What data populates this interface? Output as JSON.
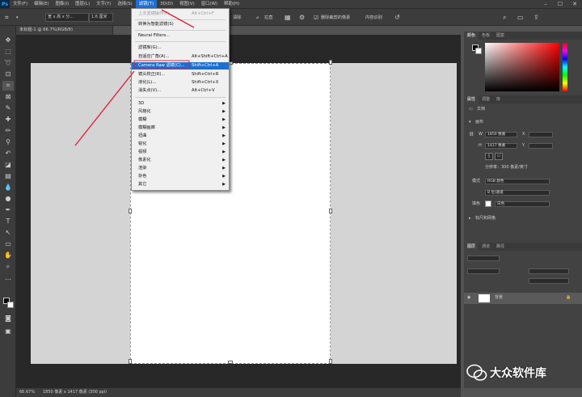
{
  "menubar": {
    "logo": "Ps",
    "items": [
      "文件(F)",
      "编辑(E)",
      "图像(I)",
      "图层(L)",
      "文字(Y)",
      "选择(S)",
      "滤镜(T)",
      "3D(D)",
      "视图(V)",
      "窗口(W)",
      "帮助(H)"
    ],
    "active_index": 6
  },
  "options": {
    "ratio": "宽 x 高 x 分...",
    "unit": "1.6 厘米",
    "clear": "清除",
    "straighten": "拉直",
    "delete_cropped": "删除裁剪的像素",
    "content_aware": "内容识别"
  },
  "doc_tab": {
    "title": "未标题-1 @ 66.7%(RGB/8)"
  },
  "status": {
    "zoom": "66.67%",
    "info": "1850 像素 x 1417 像素 (300 ppi)"
  },
  "filter_menu": {
    "items": [
      {
        "label": "上次滤镜操作(F)",
        "shortcut": "Alt+Ctrl+F",
        "disabled": true
      },
      {
        "label": "转换为智能滤镜(S)",
        "shortcut": ""
      },
      {
        "label": "Neural Filters...",
        "shortcut": ""
      },
      {
        "label": "滤镜库(G)...",
        "shortcut": ""
      },
      {
        "label": "自适应广角(A)...",
        "shortcut": "Alt+Shift+Ctrl+A"
      },
      {
        "label": "Camera Raw 滤镜(C)...",
        "shortcut": "Shift+Ctrl+A",
        "highlighted": true
      },
      {
        "label": "镜头校正(R)...",
        "shortcut": "Shift+Ctrl+R"
      },
      {
        "label": "液化(L)...",
        "shortcut": "Shift+Ctrl+X"
      },
      {
        "label": "消失点(V)...",
        "shortcut": "Alt+Ctrl+V"
      }
    ],
    "submenus": [
      "3D",
      "风格化",
      "模糊",
      "模糊画廊",
      "扭曲",
      "锐化",
      "视频",
      "像素化",
      "渲染",
      "杂色",
      "其它"
    ]
  },
  "color_panel": {
    "tabs": [
      "颜色",
      "色板",
      "图案"
    ]
  },
  "properties_panel": {
    "tabs": [
      "属性",
      "调整",
      "库"
    ],
    "doc_label": "文档",
    "section_canvas": "画布",
    "w_label": "W",
    "w_value": "1850 像素",
    "h_label": "H",
    "h_value": "1417 像素",
    "x_label": "X",
    "y_label": "Y",
    "resolution": "分辨率：300 像素/英寸",
    "mode_label": "模式",
    "mode_value": "RGB 颜色",
    "depth_value": "8 位/通道",
    "fill_label": "填色",
    "fill_value": "白色",
    "section_rulers": "标尺和网格"
  },
  "layers_panel": {
    "tabs": [
      "图层",
      "通道",
      "路径"
    ],
    "layer_name": "背景"
  },
  "watermark": {
    "text": "大众软件库"
  },
  "colors": {
    "accent": "#1c6fd1",
    "annotation": "#e0223a"
  }
}
